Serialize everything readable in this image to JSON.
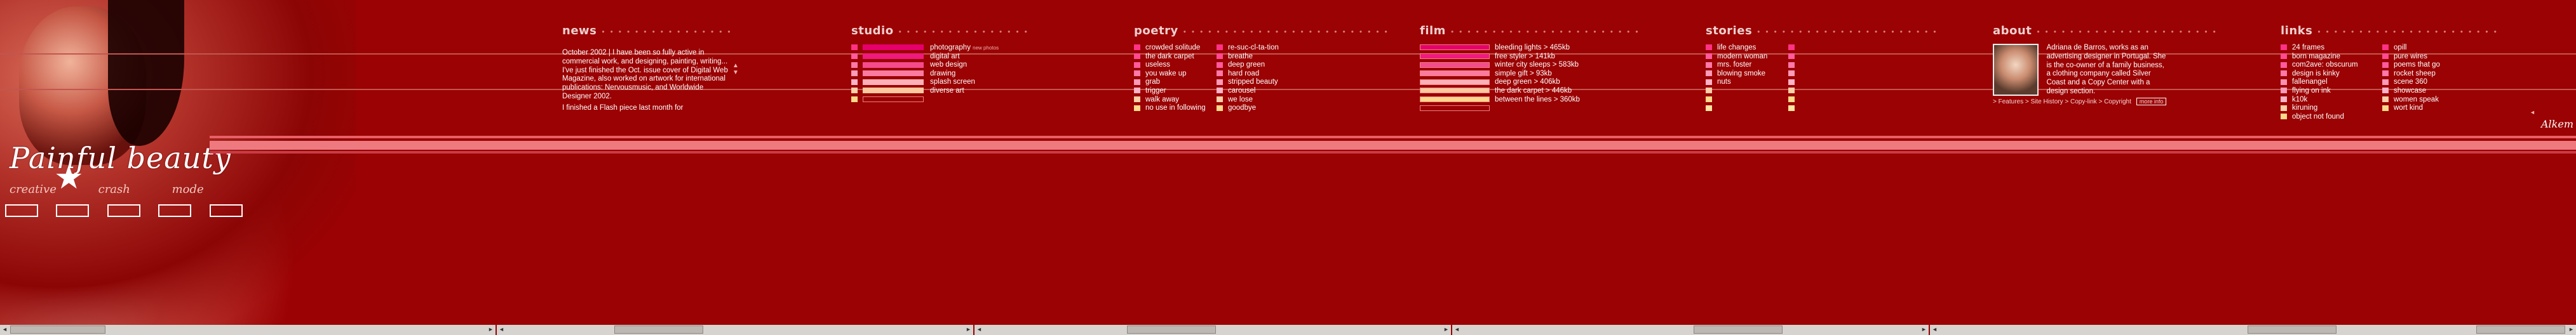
{
  "brand": {
    "title": "Painful  beauty",
    "sublabels": [
      "creative",
      "crash",
      "mode"
    ]
  },
  "sections": {
    "news": {
      "title": "news",
      "text": "October 2002 | I have been so fully active in commercial work, and designing, painting, writing... I've just finished the Oct. issue cover of Digital Web Magazine, also worked on artwork for international publications: Nervousmusic, and Worldwide Designer 2002.",
      "footer": "I finished a Flash piece last month for"
    },
    "studio": {
      "title": "studio",
      "note": "new photos",
      "items": [
        "photography",
        "digital art",
        "web design",
        "drawing",
        "splash screen",
        "diverse art"
      ]
    },
    "poetry": {
      "title": "poetry",
      "col1": [
        "crowded solitude",
        "the dark carpet",
        "useless",
        "you wake up",
        "grab",
        "trigger",
        "walk away",
        "no use in following"
      ],
      "col2": [
        "re-suc-cl-ta-tion",
        "breathe",
        "deep green",
        "hard road",
        "stripped beauty",
        "carousel",
        "we lose",
        "goodbye"
      ]
    },
    "film": {
      "title": "film",
      "items": [
        "bleeding lights > 465kb",
        "free styler > 141kb",
        "winter city sleeps > 583kb",
        "simple gift > 93kb",
        "deep green > 406kb",
        "the dark carpet > 446kb",
        "between the lines > 360kb"
      ]
    },
    "stories": {
      "title": "stories",
      "items": [
        "life changes",
        "modern woman",
        "mrs. foster",
        "blowing smoke",
        "nuts"
      ]
    },
    "about": {
      "title": "about",
      "text": "Adriana de Barros, works as an advertising designer in Portugal. She is the co-owner of a family business, a clothing company called Silver Coast and a Copy Center with a design section.",
      "links": "> Features  > Site History  > Copy-link  > Copyright",
      "button": "more info"
    },
    "links": {
      "title": "links",
      "items": [
        "24 frames",
        "born magazine",
        "com2ave: obscurum",
        "design is kinky",
        "fallenangel",
        "flying on ink",
        "k10k",
        "kiruning",
        "object not found"
      ],
      "col2": [
        "opill",
        "pure wires",
        "poems that go",
        "rocket sheep",
        "scene 360",
        "showcase",
        "women speak",
        "wort kind"
      ],
      "signature": "Alkem"
    }
  },
  "colors": {
    "background": "#9b0203",
    "accent_pink": "#e85f66",
    "rule": "#c2564f",
    "title": "#f1d0cf"
  }
}
